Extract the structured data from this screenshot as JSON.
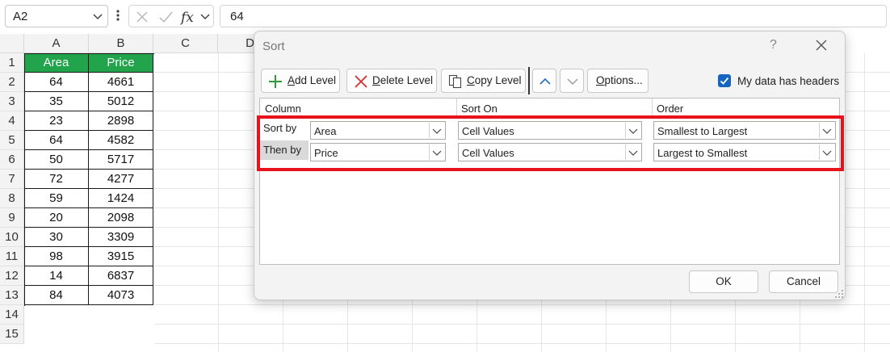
{
  "formula_bar": {
    "name_box": "A2",
    "fx_label": "fx",
    "formula_value": "64"
  },
  "sheet": {
    "columns": [
      "A",
      "B",
      "C",
      "D"
    ],
    "rows": [
      "1",
      "2",
      "3",
      "4",
      "5",
      "6",
      "7",
      "8",
      "9",
      "10",
      "11",
      "12",
      "13",
      "14",
      "15"
    ],
    "table": {
      "headers": [
        "Area",
        "Price"
      ],
      "rows": [
        [
          "64",
          "4661"
        ],
        [
          "35",
          "5012"
        ],
        [
          "23",
          "2898"
        ],
        [
          "64",
          "4582"
        ],
        [
          "50",
          "5717"
        ],
        [
          "72",
          "4277"
        ],
        [
          "59",
          "1424"
        ],
        [
          "20",
          "2098"
        ],
        [
          "30",
          "3309"
        ],
        [
          "98",
          "3915"
        ],
        [
          "14",
          "6837"
        ],
        [
          "84",
          "4073"
        ]
      ],
      "header_color": "#21a44c"
    }
  },
  "dialog": {
    "title": "Sort",
    "help": "?",
    "toolbar": {
      "add_level": "Add Level",
      "delete_level": "Delete Level",
      "copy_level": "Copy Level",
      "options": "Options...",
      "headers_checkbox_label": "My data has headers",
      "headers_checked": true
    },
    "grid": {
      "headers": {
        "column": "Column",
        "sort_on": "Sort On",
        "order": "Order"
      },
      "levels": [
        {
          "label": "Sort by",
          "column": "Area",
          "sort_on": "Cell Values",
          "order": "Smallest to Largest"
        },
        {
          "label": "Then by",
          "column": "Price",
          "sort_on": "Cell Values",
          "order": "Largest to Smallest"
        }
      ]
    },
    "ok_label": "OK",
    "cancel_label": "Cancel",
    "highlight_color": "#e8121a"
  }
}
